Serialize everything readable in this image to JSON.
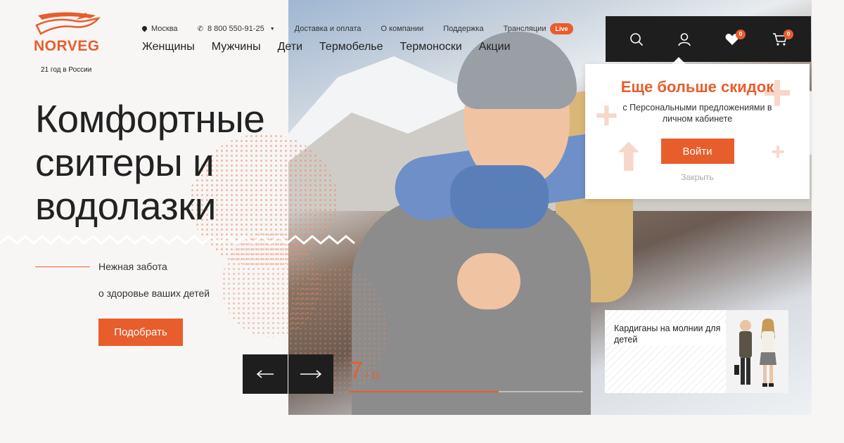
{
  "logo": {
    "name": "NORVEG",
    "subtitle": "21 год в России"
  },
  "top_links": {
    "city": "Москва",
    "phone": "8 800 550-91-25",
    "delivery": "Доставка и оплата",
    "about": "О компании",
    "support": "Поддержка",
    "broadcasts": "Трансляции",
    "live_badge": "Live"
  },
  "main_nav": {
    "women": "Женщины",
    "men": "Мужчины",
    "kids": "Дети",
    "thermal": "Термобелье",
    "thermosocks": "Термоноски",
    "sales": "Акции"
  },
  "hero": {
    "headline_line1": "Комфортные",
    "headline_line2": "свитеры и",
    "headline_line3": "водолазки",
    "tagline_line1": "Нежная забота",
    "tagline_line2": "о здоровье ваших детей",
    "cta": "Подобрать"
  },
  "slider": {
    "current": "7",
    "total": "/ 11",
    "progress": 0.64
  },
  "utility": {
    "search_icon": "search-icon",
    "account_icon": "user-icon",
    "favorites_icon": "heart-icon",
    "cart_icon": "cart-icon",
    "favorites_count": "0",
    "cart_count": "0"
  },
  "popup": {
    "title": "Еще больше скидок",
    "text": "с Персональными предложениями в личном кабинете",
    "login": "Войти",
    "close": "Закрыть"
  },
  "promo_card": {
    "title": "Кардиганы на молнии для детей"
  },
  "colors": {
    "accent": "#e85d2c",
    "dark": "#1e1e1e",
    "background": "#f7f6f5"
  }
}
